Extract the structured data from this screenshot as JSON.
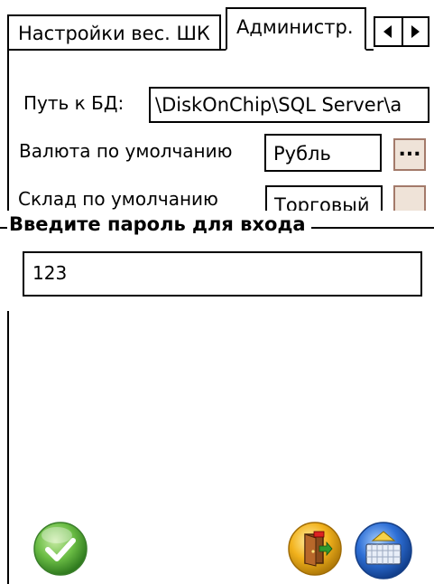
{
  "tabs": [
    {
      "label": "Настройки вес. ШК"
    },
    {
      "label": "Администр."
    }
  ],
  "form": {
    "db_path_label": "Путь к БД:",
    "db_path_value": "\\DiskOnChip\\SQL Server\\a",
    "currency_label": "Валюта по умолчанию",
    "currency_value": "Рубль",
    "currency_browse": "...",
    "warehouse_label": "Склад по умолчанию",
    "warehouse_value": "Торговый"
  },
  "password_dialog": {
    "title": "Введите пароль для входа",
    "value": "123"
  },
  "icons": {
    "ok": "checkmark-icon",
    "exit": "door-exit-icon",
    "keyboard": "keyboard-icon",
    "scroll_left": "arrow-left-icon",
    "scroll_right": "arrow-right-icon"
  },
  "colors": {
    "browse_button_bg": "#efe3d8",
    "ok_button": "#5fae3c",
    "exit_button": "#f2b21d",
    "keyboard_button": "#2e6fd6"
  }
}
